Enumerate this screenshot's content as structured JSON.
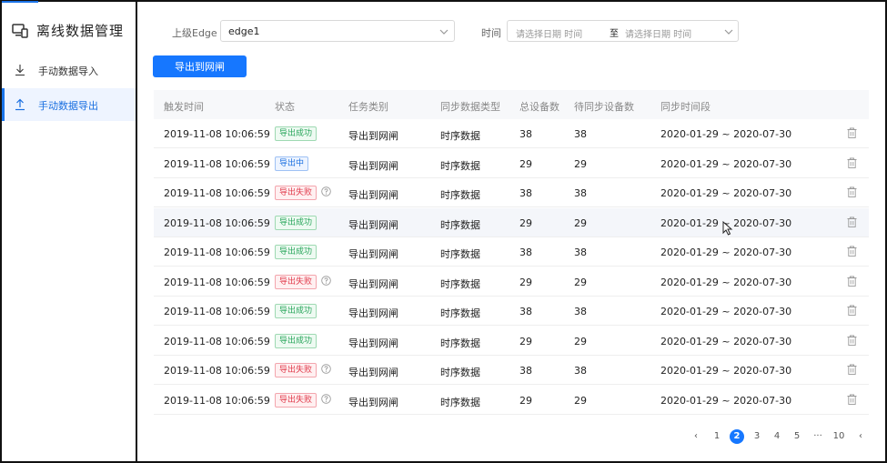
{
  "sidebar": {
    "title": "离线数据管理",
    "items": [
      {
        "label": "手动数据导入",
        "icon": "download-icon",
        "active": false
      },
      {
        "label": "手动数据导出",
        "icon": "upload-icon",
        "active": true
      }
    ]
  },
  "filters": {
    "edge_label": "上级Edge",
    "edge_value": "edge1",
    "time_label": "时间",
    "start_placeholder": "请选择日期  时间",
    "separator": "至",
    "end_placeholder": "请选择日期  时间"
  },
  "toolbar": {
    "export_label": "导出到网闸"
  },
  "table": {
    "columns": [
      "触发时间",
      "状态",
      "任务类别",
      "同步数据类型",
      "总设备数",
      "待同步设备数",
      "同步时间段"
    ],
    "rows": [
      {
        "time": "2019-11-08 10:06:59",
        "status": "导出成功",
        "status_type": "success",
        "category": "导出到网闸",
        "data_type": "时序数据",
        "total": "38",
        "pending": "38",
        "period": "2020-01-29 ~ 2020-07-30"
      },
      {
        "time": "2019-11-08 10:06:59",
        "status": "导出中",
        "status_type": "running",
        "category": "导出到网闸",
        "data_type": "时序数据",
        "total": "29",
        "pending": "29",
        "period": "2020-01-29 ~ 2020-07-30"
      },
      {
        "time": "2019-11-08 10:06:59",
        "status": "导出失败",
        "status_type": "failed",
        "category": "导出到网闸",
        "data_type": "时序数据",
        "total": "38",
        "pending": "38",
        "period": "2020-01-29 ~ 2020-07-30"
      },
      {
        "time": "2019-11-08 10:06:59",
        "status": "导出成功",
        "status_type": "success",
        "category": "导出到网闸",
        "data_type": "时序数据",
        "total": "29",
        "pending": "29",
        "period": "2020-01-29 ~ 2020-07-30"
      },
      {
        "time": "2019-11-08 10:06:59",
        "status": "导出成功",
        "status_type": "success",
        "category": "导出到网闸",
        "data_type": "时序数据",
        "total": "38",
        "pending": "38",
        "period": "2020-01-29 ~ 2020-07-30"
      },
      {
        "time": "2019-11-08 10:06:59",
        "status": "导出失败",
        "status_type": "failed",
        "category": "导出到网闸",
        "data_type": "时序数据",
        "total": "29",
        "pending": "29",
        "period": "2020-01-29 ~ 2020-07-30"
      },
      {
        "time": "2019-11-08 10:06:59",
        "status": "导出成功",
        "status_type": "success",
        "category": "导出到网闸",
        "data_type": "时序数据",
        "total": "38",
        "pending": "38",
        "period": "2020-01-29 ~ 2020-07-30"
      },
      {
        "time": "2019-11-08 10:06:59",
        "status": "导出成功",
        "status_type": "success",
        "category": "导出到网闸",
        "data_type": "时序数据",
        "total": "29",
        "pending": "29",
        "period": "2020-01-29 ~ 2020-07-30"
      },
      {
        "time": "2019-11-08 10:06:59",
        "status": "导出失败",
        "status_type": "failed",
        "category": "导出到网闸",
        "data_type": "时序数据",
        "total": "38",
        "pending": "38",
        "period": "2020-01-29 ~ 2020-07-30"
      },
      {
        "time": "2019-11-08 10:06:59",
        "status": "导出失败",
        "status_type": "failed",
        "category": "导出到网闸",
        "data_type": "时序数据",
        "total": "29",
        "pending": "29",
        "period": "2020-01-29 ~ 2020-07-30"
      }
    ]
  },
  "pagination": {
    "prev": "‹",
    "pages": [
      "1",
      "2",
      "3",
      "4",
      "5"
    ],
    "current": "2",
    "ellipsis": "···",
    "last": "10",
    "next": "‹"
  },
  "colors": {
    "accent": "#1677ff",
    "success": "#27a55a",
    "failed": "#e0394a"
  }
}
